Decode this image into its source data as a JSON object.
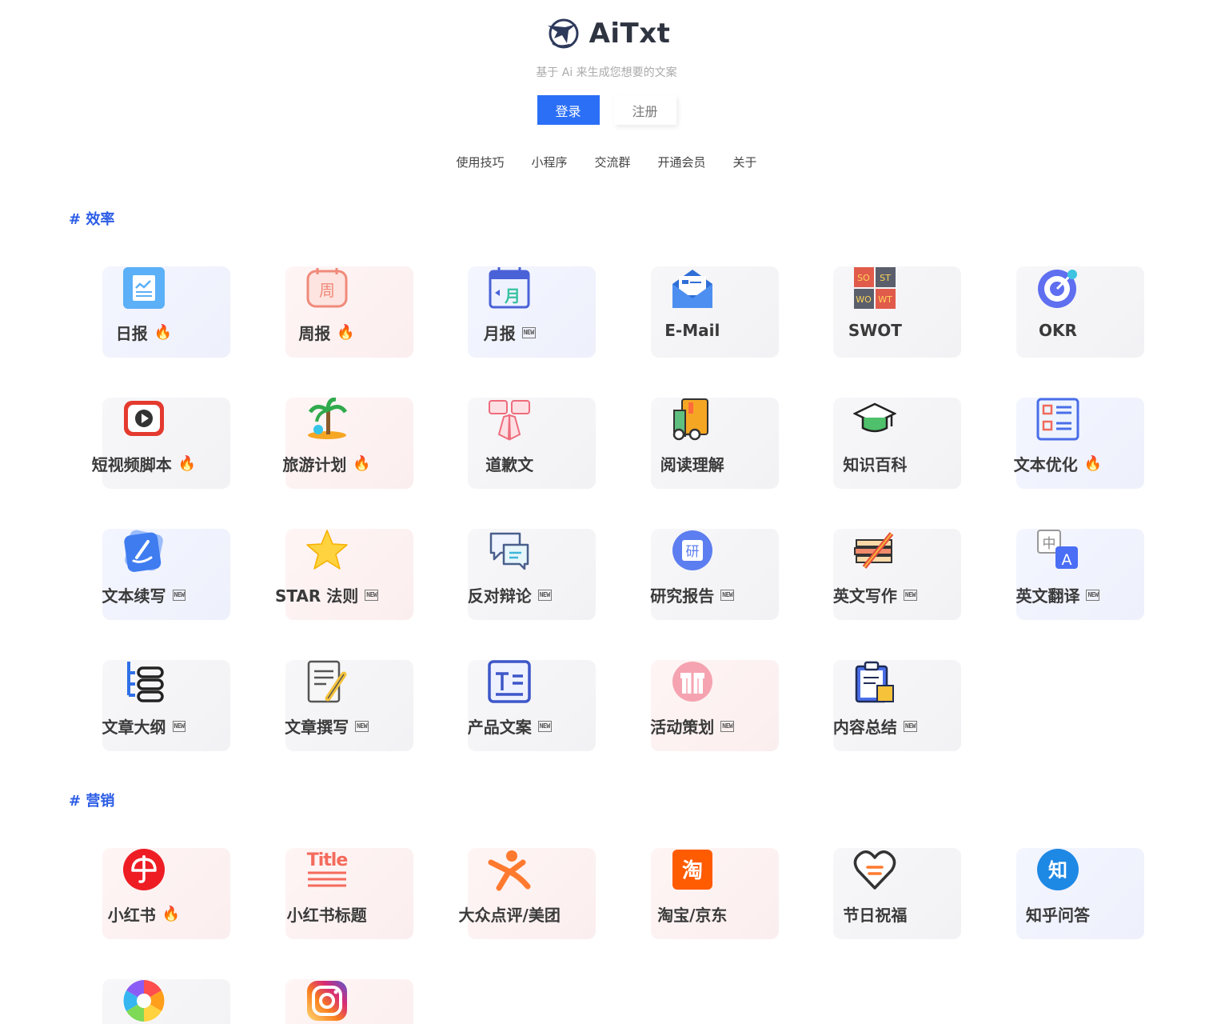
{
  "brand": {
    "name": "AiTxt",
    "subtitle": "基于 Ai 来生成您想要的文案"
  },
  "auth": {
    "login_label": "登录",
    "register_label": "注册"
  },
  "nav": [
    "使用技巧",
    "小程序",
    "交流群",
    "开通会员",
    "关于"
  ],
  "badges": {
    "new": "NEW",
    "hot": "🔥"
  },
  "sections": [
    {
      "title": "# 效率",
      "items": [
        {
          "label": "日报",
          "icon": "chart-doc-icon",
          "badge": "hot"
        },
        {
          "label": "周报",
          "icon": "week-calendar-icon",
          "badge": "hot"
        },
        {
          "label": "月报",
          "icon": "month-calendar-icon",
          "badge": "new"
        },
        {
          "label": "E-Mail",
          "icon": "envelope-icon",
          "badge": ""
        },
        {
          "label": "SWOT",
          "icon": "swot-grid-icon",
          "badge": ""
        },
        {
          "label": "OKR",
          "icon": "target-icon",
          "badge": ""
        },
        {
          "label": "短视频脚本",
          "icon": "play-icon",
          "badge": "hot"
        },
        {
          "label": "旅游计划",
          "icon": "palm-tree-icon",
          "badge": "hot"
        },
        {
          "label": "道歉文",
          "icon": "pray-hands-icon",
          "badge": ""
        },
        {
          "label": "阅读理解",
          "icon": "book-glasses-icon",
          "badge": ""
        },
        {
          "label": "知识百科",
          "icon": "graduation-cap-icon",
          "badge": ""
        },
        {
          "label": "文本优化",
          "icon": "list-doc-icon",
          "badge": "hot"
        },
        {
          "label": "文本续写",
          "icon": "pen-card-icon",
          "badge": "new"
        },
        {
          "label": "STAR 法则",
          "icon": "star-icon",
          "badge": "new"
        },
        {
          "label": "反对辩论",
          "icon": "chat-bubbles-icon",
          "badge": "new"
        },
        {
          "label": "研究报告",
          "icon": "research-badge-icon",
          "badge": "new"
        },
        {
          "label": "英文写作",
          "icon": "pencil-books-icon",
          "badge": "new"
        },
        {
          "label": "英文翻译",
          "icon": "translate-icon",
          "badge": "new"
        },
        {
          "label": "文章大纲",
          "icon": "outline-icon",
          "badge": "new"
        },
        {
          "label": "文章撰写",
          "icon": "doc-pencil-icon",
          "badge": "new"
        },
        {
          "label": "产品文案",
          "icon": "text-frame-icon",
          "badge": "new"
        },
        {
          "label": "活动策划",
          "icon": "gift-icon",
          "badge": "new"
        },
        {
          "label": "内容总结",
          "icon": "clipboard-icon",
          "badge": "new"
        }
      ]
    },
    {
      "title": "# 营销",
      "items": [
        {
          "label": "小红书",
          "icon": "xiaohongshu-icon",
          "badge": "hot"
        },
        {
          "label": "小红书标题",
          "icon": "title-text-icon",
          "badge": ""
        },
        {
          "label": "大众点评/美团",
          "icon": "dianping-icon",
          "badge": ""
        },
        {
          "label": "淘宝/京东",
          "icon": "taobao-icon",
          "badge": ""
        },
        {
          "label": "节日祝福",
          "icon": "heart-icon",
          "badge": ""
        },
        {
          "label": "知乎问答",
          "icon": "zhihu-icon",
          "badge": ""
        },
        {
          "label": "",
          "icon": "aperture-icon",
          "badge": ""
        },
        {
          "label": "",
          "icon": "instagram-icon",
          "badge": ""
        }
      ]
    }
  ]
}
